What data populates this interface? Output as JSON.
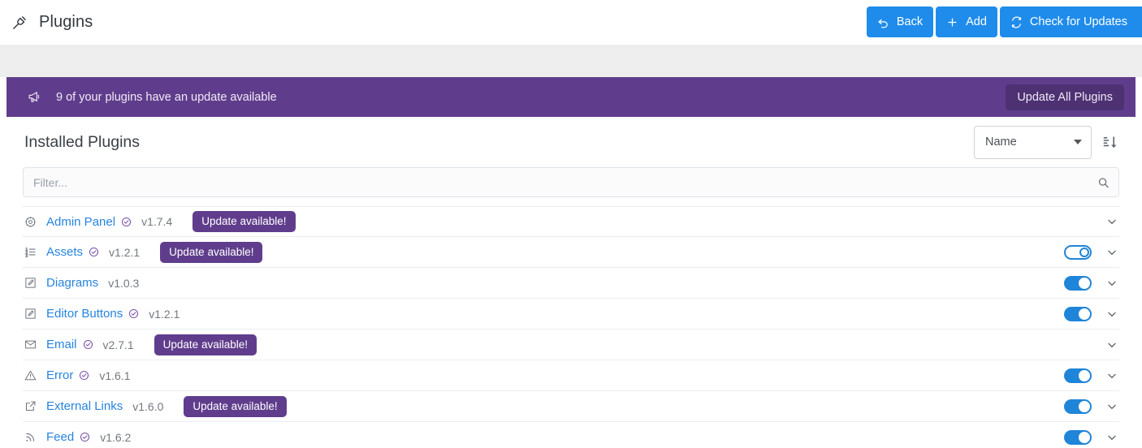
{
  "topbar": {
    "icon": "plug-icon",
    "title": "Plugins",
    "actions": [
      {
        "label": "Back",
        "icon": "undo-icon"
      },
      {
        "label": "Add",
        "icon": "plus-icon"
      },
      {
        "label": "Check for Updates",
        "icon": "refresh-icon"
      }
    ],
    "accent_color": "#1f8ceb"
  },
  "banner": {
    "icon": "megaphone-icon",
    "message": "9 of your plugins have an update available",
    "button_label": "Update All Plugins",
    "background_color": "#603d8c",
    "button_color": "#4e3173"
  },
  "panel": {
    "title": "Installed Plugins",
    "sort": {
      "selected": "Name",
      "options": [
        "Name"
      ],
      "direction_icon": "sort-amount-down-icon"
    },
    "filter": {
      "value": "",
      "placeholder": "Filter...",
      "icon": "search-icon"
    },
    "update_badge_label": "Update available!",
    "plugins": [
      {
        "icon": "cog-icon",
        "name": "Admin Panel",
        "verified": true,
        "version": "v1.7.4",
        "update_available": true,
        "toggle": null
      },
      {
        "icon": "list-ol-icon",
        "name": "Assets",
        "verified": true,
        "version": "v1.2.1",
        "update_available": true,
        "toggle": "pending"
      },
      {
        "icon": "pen-square-icon",
        "name": "Diagrams",
        "verified": false,
        "version": "v1.0.3",
        "update_available": false,
        "toggle": "on"
      },
      {
        "icon": "pen-square-icon",
        "name": "Editor Buttons",
        "verified": true,
        "version": "v1.2.1",
        "update_available": false,
        "toggle": "on"
      },
      {
        "icon": "envelope-icon",
        "name": "Email",
        "verified": true,
        "version": "v2.7.1",
        "update_available": true,
        "toggle": null
      },
      {
        "icon": "warning-triangle-icon",
        "name": "Error",
        "verified": true,
        "version": "v1.6.1",
        "update_available": false,
        "toggle": "on"
      },
      {
        "icon": "external-link-icon",
        "name": "External Links",
        "verified": false,
        "version": "v1.6.0",
        "update_available": true,
        "toggle": "on"
      },
      {
        "icon": "rss-icon",
        "name": "Feed",
        "verified": true,
        "version": "v1.6.2",
        "update_available": false,
        "toggle": "on"
      }
    ]
  }
}
